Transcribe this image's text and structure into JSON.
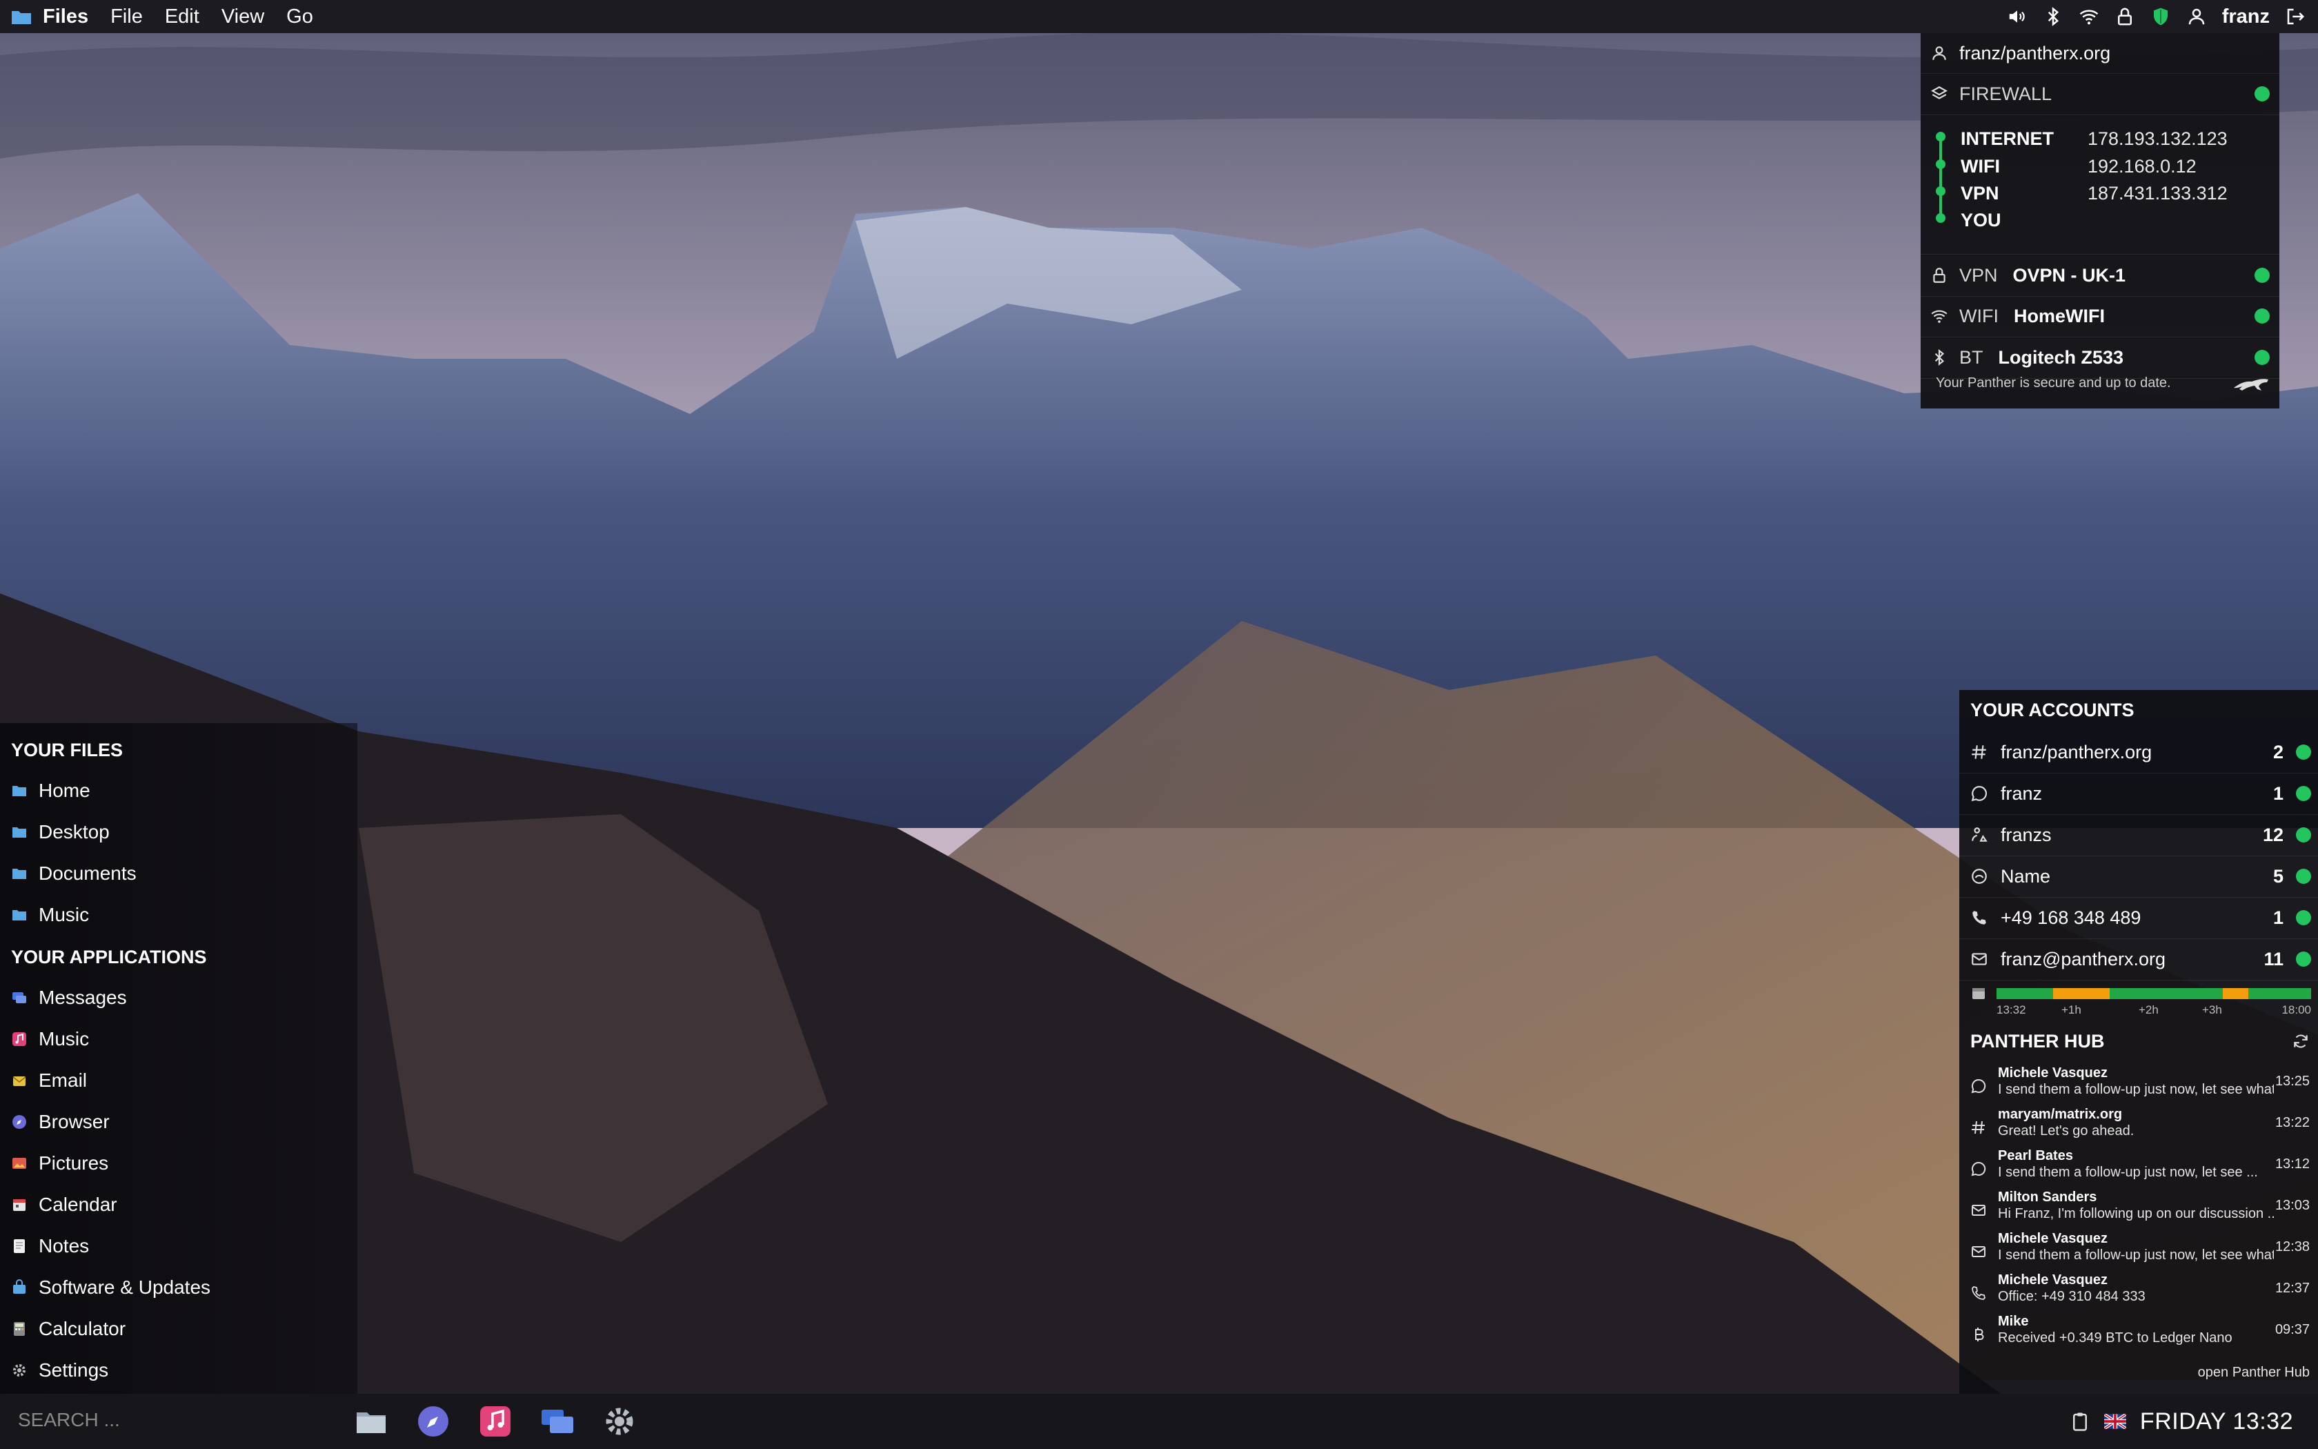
{
  "colors": {
    "status_green": "#22c55e",
    "timeline_busy": "#f59e0b",
    "timeline_free": "#22a745",
    "panel_bg": "#141418",
    "folder_blue": "#5aa9e6"
  },
  "topbar": {
    "app_icon": "folder-icon",
    "app_name": "Files",
    "menu": [
      "File",
      "Edit",
      "View",
      "Go"
    ],
    "status_icons": [
      "volume-icon",
      "bluetooth-icon",
      "wifi-icon",
      "lock-icon",
      "shield-icon",
      "user-icon"
    ],
    "user_name": "franz",
    "logout_icon": "logout-icon"
  },
  "network_panel": {
    "account": "franz/pantherx.org",
    "firewall_label": "FIREWALL",
    "chain": [
      {
        "label": "INTERNET",
        "ip": "178.193.132.123"
      },
      {
        "label": "WIFI",
        "ip": "192.168.0.12"
      },
      {
        "label": "VPN",
        "ip": "187.431.133.312"
      },
      {
        "label": "YOU",
        "ip": ""
      }
    ],
    "connections": [
      {
        "icon": "lock-icon",
        "kind": "VPN",
        "value": "OVPN - UK-1"
      },
      {
        "icon": "wifi-icon",
        "kind": "WIFI",
        "value": "HomeWIFI"
      },
      {
        "icon": "bluetooth-icon",
        "kind": "BT",
        "value": "Logitech Z533"
      }
    ],
    "footer": "Your Panther is secure and up to date.",
    "footer_icon": "panther-icon"
  },
  "sidebar": {
    "files_heading": "YOUR FILES",
    "files": [
      {
        "label": "Home",
        "icon": "folder-icon"
      },
      {
        "label": "Desktop",
        "icon": "folder-icon"
      },
      {
        "label": "Documents",
        "icon": "folder-icon"
      },
      {
        "label": "Music",
        "icon": "folder-icon"
      }
    ],
    "apps_heading": "YOUR APPLICATIONS",
    "apps": [
      {
        "label": "Messages",
        "icon": "messages-icon",
        "color": "#4a78e0"
      },
      {
        "label": "Music",
        "icon": "music-icon",
        "color": "#e2417a"
      },
      {
        "label": "Email",
        "icon": "email-icon",
        "color": "#e8c13a"
      },
      {
        "label": "Browser",
        "icon": "browser-icon",
        "color": "#6a6ad8"
      },
      {
        "label": "Pictures",
        "icon": "pictures-icon",
        "color": "#e05a4a"
      },
      {
        "label": "Calendar",
        "icon": "calendar-icon",
        "color": "#e6e6e6"
      },
      {
        "label": "Notes",
        "icon": "notes-icon",
        "color": "#f0f0f0"
      },
      {
        "label": "Software & Updates",
        "icon": "software-icon",
        "color": "#5aa9e6"
      },
      {
        "label": "Calculator",
        "icon": "calculator-icon",
        "color": "#8a8a8a"
      },
      {
        "label": "Settings",
        "icon": "settings-icon",
        "color": "#bbbbbb"
      }
    ]
  },
  "accounts": {
    "title": "YOUR ACCOUNTS",
    "items": [
      {
        "icon": "matrix-icon",
        "name": "franz/pantherx.org",
        "count": "2"
      },
      {
        "icon": "whatsapp-icon",
        "name": "franz",
        "count": "1"
      },
      {
        "icon": "telegram-icon",
        "name": "franzs",
        "count": "12"
      },
      {
        "icon": "signal-icon",
        "name": "Name",
        "count": "5"
      },
      {
        "icon": "phone-icon",
        "name": "+49 168 348 489",
        "count": "1"
      },
      {
        "icon": "mail-icon",
        "name": "franz@pantherx.org",
        "count": "11"
      }
    ],
    "timeline_icon": "calendar-icon",
    "timeline_ticks": [
      "13:32",
      "+1h",
      "+2h",
      "+3h",
      "18:00"
    ],
    "timeline_segments": [
      {
        "state": "free",
        "share": 0.18
      },
      {
        "state": "busy",
        "share": 0.18
      },
      {
        "state": "free",
        "share": 0.36
      },
      {
        "state": "busy",
        "share": 0.08
      },
      {
        "state": "free",
        "share": 0.2
      }
    ]
  },
  "hub": {
    "title": "PANTHER HUB",
    "refresh_icon": "refresh-icon",
    "messages": [
      {
        "icon": "whatsapp-icon",
        "from": "Michele Vasquez",
        "text": "I send them a follow-up just now, let see what ...",
        "time": "13:25"
      },
      {
        "icon": "matrix-icon",
        "from": "maryam/matrix.org",
        "text": "Great! Let's go ahead.",
        "time": "13:22"
      },
      {
        "icon": "whatsapp-icon",
        "from": "Pearl Bates",
        "text": "I send them a follow-up just now, let see ...",
        "time": "13:12"
      },
      {
        "icon": "mail-icon",
        "from": "Milton Sanders",
        "text": "Hi Franz, I'm following up on our discussion ...",
        "time": "13:03"
      },
      {
        "icon": "mail-icon",
        "from": "Michele Vasquez",
        "text": "I send them a follow-up just now, let see what ...",
        "time": "12:38"
      },
      {
        "icon": "phone-icon",
        "from": "Michele Vasquez",
        "text": "Office: +49 310 484 333",
        "time": "12:37"
      },
      {
        "icon": "bitcoin-icon",
        "from": "Mike",
        "text": "Received +0.349 BTC to Ledger Nano",
        "time": "09:37"
      }
    ],
    "open_label": "open Panther Hub"
  },
  "taskbar": {
    "search_placeholder": "SEARCH ...",
    "dock": [
      "files-icon",
      "browser-icon",
      "music-icon",
      "messages-icon",
      "settings-icon"
    ],
    "tray_icons": [
      "clipboard-icon",
      "uk-flag-icon"
    ],
    "clock": "FRIDAY 13:32"
  }
}
